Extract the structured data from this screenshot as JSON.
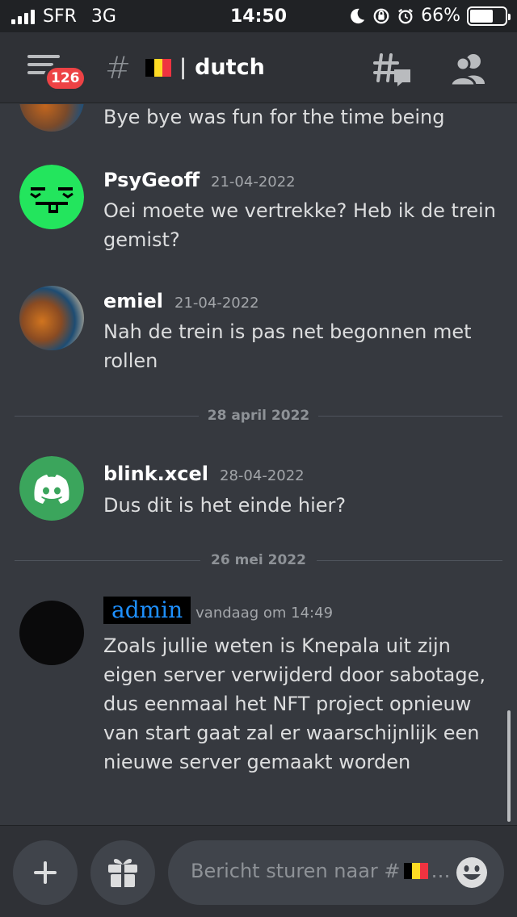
{
  "status_bar": {
    "carrier": "SFR",
    "network": "3G",
    "time": "14:50",
    "battery": "66%",
    "battery_level": 0.66
  },
  "header": {
    "notification_count": "126",
    "channel_name": "dutch",
    "separator": "|"
  },
  "messages": [
    {
      "author": "",
      "time": "",
      "text": "Bye bye was fun for the time being"
    },
    {
      "author": "PsyGeoff",
      "time": "21-04-2022",
      "text": "Oei moete we vertrekke? Heb ik de trein gemist?"
    },
    {
      "author": "emiel",
      "time": "21-04-2022",
      "text": "Nah de trein is pas net begonnen met rollen"
    },
    {
      "author": "blink.xcel",
      "time": "28-04-2022",
      "text": "Dus dit is het einde hier?"
    },
    {
      "author": "admin",
      "time": "vandaag om 14:49",
      "text": "Zoals jullie weten is Knepala uit zijn eigen server verwijderd door sabotage, dus eenmaal het NFT project opnieuw van start gaat zal er waarschijnlijk een nieuwe server gemaakt worden"
    }
  ],
  "dividers": [
    "28 april 2022",
    "26 mei 2022"
  ],
  "composer": {
    "placeholder_text": "Bericht sturen naar #",
    "ellipsis": "…"
  },
  "colors": {
    "background": "#36393f",
    "header": "#2f3136",
    "badge": "#ed4245",
    "psygeoff_avatar": "#23e55d",
    "blink_avatar": "#3ba55c",
    "admin_name": "#1e90ff"
  },
  "icons": [
    "signal-icon",
    "moon-icon",
    "orientation-lock-icon",
    "alarm-icon",
    "battery-icon",
    "menu-icon",
    "hash-icon",
    "belgium-flag-icon",
    "threads-icon",
    "members-icon",
    "plus-icon",
    "gift-icon",
    "emoji-icon",
    "discord-logo-icon"
  ]
}
